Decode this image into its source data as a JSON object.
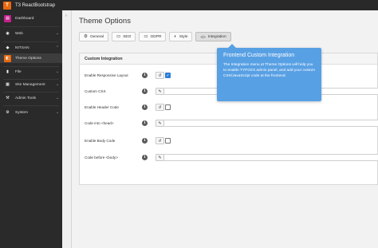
{
  "app": {
    "site_name": "T3 ReactBootstrap",
    "logo_glyph": "T"
  },
  "sidebar": {
    "items": [
      {
        "label": "Dashboard",
        "icon": "dashboard-icon",
        "glyph": "▤",
        "icon_color": "#c3208a",
        "chevron": ""
      },
      {
        "label": "Web",
        "icon": "globe-icon",
        "glyph": "◉",
        "icon_color": "#2a2a2a",
        "chevron": "⌄"
      },
      {
        "label": "NITSAN",
        "icon": "nitsan-icon",
        "glyph": "◆",
        "icon_color": "#2a2a2a",
        "chevron": "⌃"
      },
      {
        "label": "Theme Options",
        "icon": "theme-options-icon",
        "glyph": "◧",
        "icon_color": "#e8690f",
        "chevron": ""
      },
      {
        "label": "File",
        "icon": "file-icon",
        "glyph": "▮",
        "icon_color": "#2a2a2a",
        "chevron": "⌄"
      },
      {
        "label": "Site Management",
        "icon": "sitemap-icon",
        "glyph": "▦",
        "icon_color": "#2a2a2a",
        "chevron": "⌄"
      },
      {
        "label": "Admin Tools",
        "icon": "admin-tools-icon",
        "glyph": "⚒",
        "icon_color": "#2a2a2a",
        "chevron": "⌄"
      },
      {
        "label": "System",
        "icon": "system-icon",
        "glyph": "⚙",
        "icon_color": "#2a2a2a",
        "chevron": "⌄"
      }
    ],
    "collapse_glyph": "›"
  },
  "main": {
    "title": "Theme Options",
    "tabs": [
      {
        "label": "General",
        "glyph": "⚙"
      },
      {
        "label": "SEO",
        "glyph": "▭"
      },
      {
        "label": "GDPR",
        "glyph": "▭"
      },
      {
        "label": "Style",
        "glyph": "◐"
      },
      {
        "label": "Integration",
        "glyph": "</>"
      }
    ],
    "panel_title": "Custom Integration",
    "rows": [
      {
        "label": "Enable Responsive Layout",
        "type": "checkbox",
        "checked": true
      },
      {
        "label": "Custom CSS",
        "type": "text"
      },
      {
        "label": "Enable Header Code",
        "type": "checkbox",
        "checked": false
      },
      {
        "label": "Code into <head>",
        "type": "text"
      },
      {
        "label": "Enable Body Code",
        "type": "checkbox",
        "checked": false
      },
      {
        "label": "Code before <body>",
        "type": "text"
      }
    ],
    "info_glyph": "i",
    "reset_glyph": "↺",
    "edit_glyph": "✎",
    "check_glyph": "✓"
  },
  "tooltip": {
    "title": "Frontend Custom Integration",
    "body": "The Integration menu at Theme Options will help you to enable TYPO3's admin panel, and add your custom CSS/JavaScript code at the frontend."
  },
  "colors": {
    "accent": "#58a0e4",
    "checkbox": "#2b7fd6",
    "brand": "#e8690f"
  }
}
